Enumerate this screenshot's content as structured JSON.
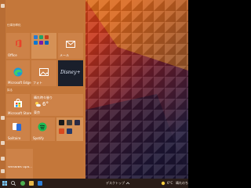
{
  "start_menu": {
    "group1_header": "仕事効率化",
    "group2_header": "探る",
    "tiles": {
      "office": "Office",
      "edge": "Microsoft Edge",
      "photos": "フォト",
      "mail": "メール",
      "disney": "Disney+",
      "store": "Microsoft Store",
      "weather_condition": "晴れ時々曇り",
      "weather_temp": "6°",
      "weather_city": "東京",
      "solitaire": "Solitaire",
      "spotify": "Spotify",
      "update": "Windows Upd..."
    }
  },
  "taskbar": {
    "desktop": "デスクトップ",
    "temp": "6°C",
    "weather": "晴れのち"
  },
  "colors": {
    "start_bg": "#c4773a",
    "tile": "#cd8248",
    "taskbar": "#2a1d18"
  },
  "icons": [
    "office-icon",
    "edge-icon",
    "photos-icon",
    "mail-icon",
    "disney-plus-logo",
    "store-icon",
    "weather-icon",
    "solitaire-icon",
    "spotify-icon",
    "update-icon",
    "windows-start-icon",
    "search-icon",
    "edge-taskbar-icon",
    "explorer-icon"
  ]
}
